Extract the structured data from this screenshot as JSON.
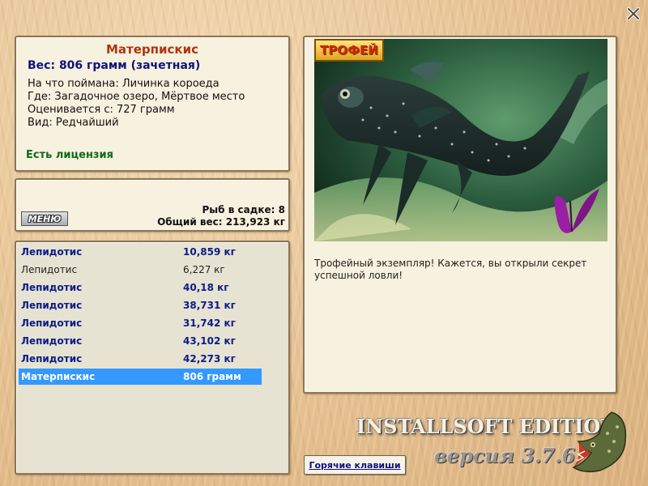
{
  "info": {
    "title": "Матерпискис",
    "weight_line": "Вес: 806 грамм (зачетная)",
    "bait_line": "На что поймана: Личинка короеда",
    "place_line": "Где: Загадочное озеро, Мёртвое место",
    "valued_line": "Оценивается с: 727 грамм",
    "kind_line": "Вид: Редчайший",
    "license": "Есть лицензия"
  },
  "keep": {
    "menu_label": "МЕНЮ",
    "count_line": "Рыб в садке: 8",
    "total_line": "Общий вес: 213,923 кг"
  },
  "fish_list": [
    {
      "name": "Лепидотис",
      "weight": "10,859 кг",
      "style": "bold"
    },
    {
      "name": "Лепидотис",
      "weight": "6,227 кг",
      "style": "normal"
    },
    {
      "name": "Лепидотис",
      "weight": "40,18 кг",
      "style": "bold"
    },
    {
      "name": "Лепидотис",
      "weight": "38,731 кг",
      "style": "bold"
    },
    {
      "name": "Лепидотис",
      "weight": "31,742 кг",
      "style": "bold"
    },
    {
      "name": "Лепидотис",
      "weight": "43,102 кг",
      "style": "bold"
    },
    {
      "name": "Лепидотис",
      "weight": "42,273 кг",
      "style": "bold"
    },
    {
      "name": "Матерпискис",
      "weight": "806 грамм",
      "style": "selected"
    }
  ],
  "photo": {
    "badge": "ТРОФЕЙ",
    "caption": "Трофейный экземпляр! Кажется, вы открыли секрет успешной ловли!"
  },
  "footer": {
    "hotkeys_label": "Горячие клавиши",
    "brand": "INSTALLSOFT EDITION",
    "version": "версия 3.7.6"
  },
  "colors": {
    "title": "#b0350b",
    "accent_blue": "#10137a",
    "license_green": "#0e6a17",
    "selection": "#3399ff"
  },
  "icons": {
    "close": "close-icon",
    "trophy_fish": "fish-photo",
    "pike": "pike-logo-icon"
  }
}
